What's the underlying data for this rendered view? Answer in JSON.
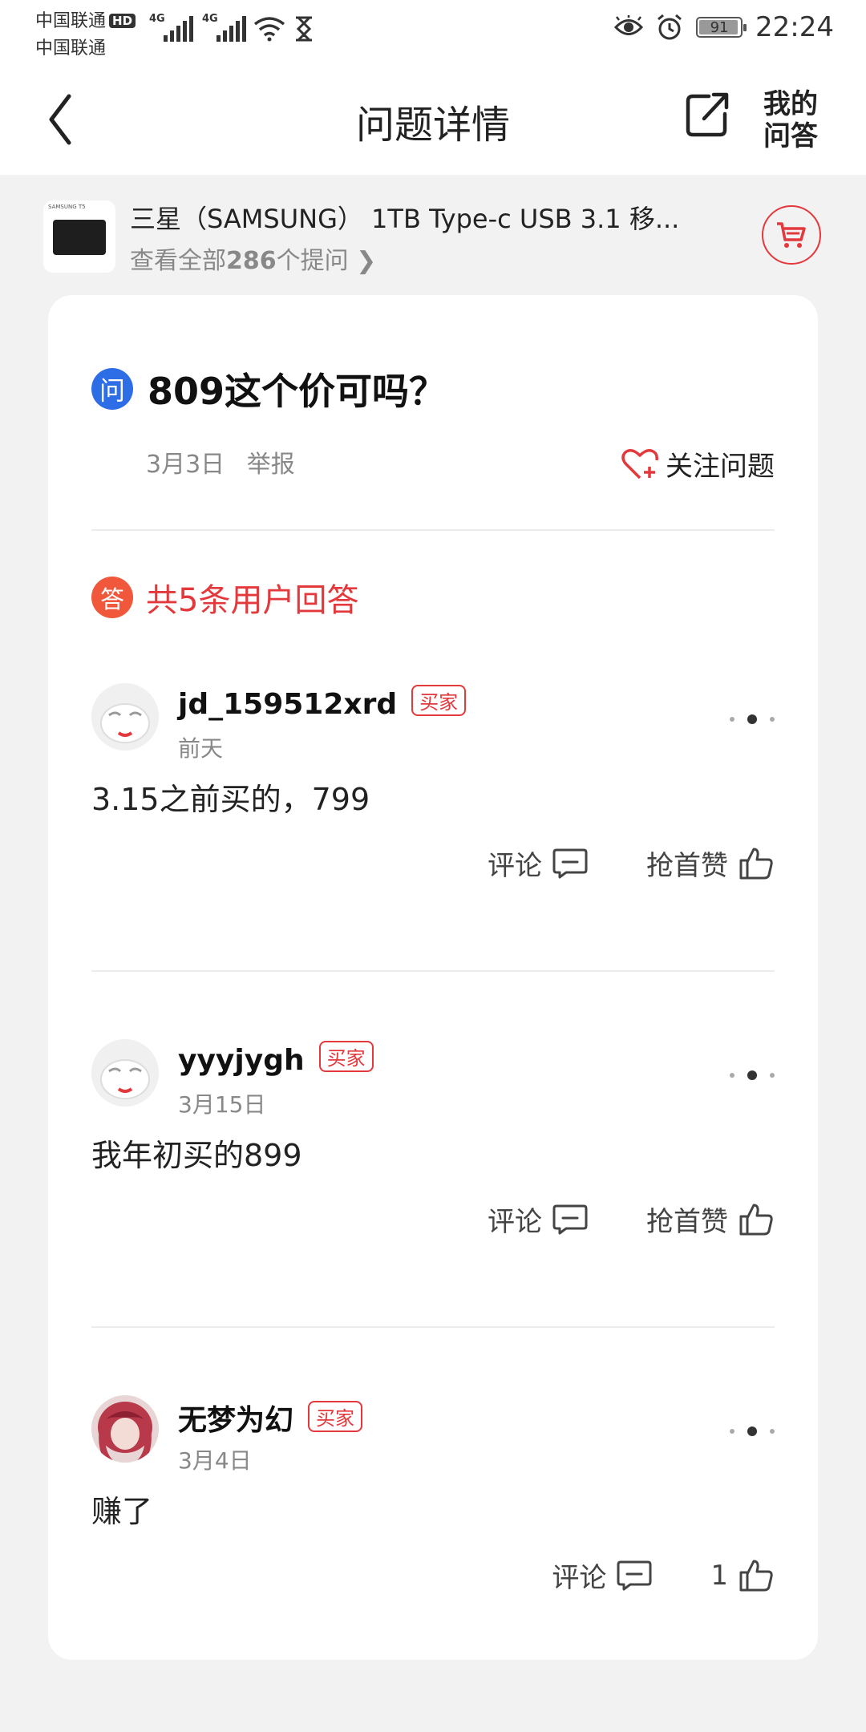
{
  "status_bar": {
    "carrier1": "中国联通",
    "carrier1_badge": "HD",
    "carrier2": "中国联通",
    "signal1_label": "4G",
    "signal2_label": "4G",
    "battery": "91",
    "time": "22:24"
  },
  "header": {
    "title": "问题详情",
    "my_qa": "我的问答"
  },
  "product": {
    "brand_text": "SAMSUNG T5",
    "name": "三星（SAMSUNG） 1TB Type-c USB 3.1 移...",
    "link_prefix": "查看全部",
    "link_count": "286",
    "link_suffix": "个提问 ❯"
  },
  "question": {
    "badge": "问",
    "title": "809这个价可吗？",
    "date": "3月3日",
    "report": "举报",
    "follow": "关注问题"
  },
  "answers_header": {
    "badge": "答",
    "count": "共5条用户回答"
  },
  "answers": [
    {
      "user": "jd_159512xrd",
      "badge": "买家",
      "date": "前天",
      "content": "3.15之前买的，799",
      "comment": "评论",
      "like": "抢首赞"
    },
    {
      "user": "yyyjygh",
      "badge": "买家",
      "date": "3月15日",
      "content": "我年初买的899",
      "comment": "评论",
      "like": "抢首赞"
    },
    {
      "user": "无梦为幻",
      "badge": "买家",
      "date": "3月4日",
      "content": "赚了",
      "comment": "评论",
      "like": "1"
    }
  ],
  "colors": {
    "accent_red": "#e4393c",
    "question_blue": "#2d6ee6",
    "answer_orange": "#f0573b"
  }
}
